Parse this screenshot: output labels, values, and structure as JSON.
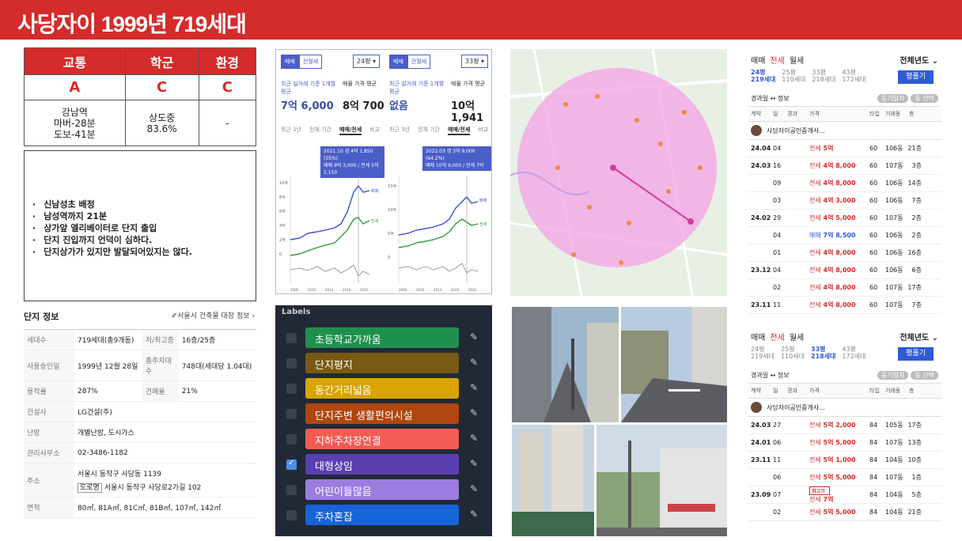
{
  "title": "사당자이 1999년 719세대",
  "rating": {
    "headers": [
      "교통",
      "학군",
      "환경"
    ],
    "grades": [
      "A",
      "C",
      "C"
    ],
    "details": [
      [
        "강남역",
        "마버-28분",
        "도보-41분"
      ],
      [
        "상도중",
        "83.6%"
      ],
      [
        "-"
      ]
    ]
  },
  "notes": [
    "신남성초 배정",
    "남성역까지 21분",
    "상가앞 엘리베이터로 단지 출입",
    "단지 진입까지 언덕이 심하다.",
    "단지상가가 있지만 발달되어있지는 않다."
  ],
  "info": {
    "title": "단지 정보",
    "link": "서울시 건축물 대장 정보",
    "rows": [
      {
        "k1": "세대수",
        "v1": "719세대(총9개동)",
        "k2": "저/최고층",
        "v2": "16층/25층"
      },
      {
        "k1": "사용승인일",
        "v1": "1999년 12월 28일",
        "k2": "총주차대수",
        "v2": "748대(세대당 1.04대)"
      },
      {
        "k1": "용적률",
        "v1": "287%",
        "k2": "건폐율",
        "v2": "21%"
      }
    ],
    "builder": {
      "k": "건설사",
      "v": "LG건설(주)"
    },
    "heating": {
      "k": "난방",
      "v": "개별난방, 도시가스"
    },
    "office": {
      "k": "관리사무소",
      "v": "02-3486-1182"
    },
    "address": {
      "k": "주소",
      "v1": "서울시 동작구 사당동 1139",
      "badge": "도로명",
      "v2": "서울시 동작구 사당로2가길 102"
    },
    "area": {
      "k": "면적",
      "v": "80㎡, 81A㎡, 81C㎡, 81B㎡, 107㎡, 142㎡"
    }
  },
  "charts": [
    {
      "tab1": "매매",
      "tab2": "전월세",
      "select": "24평",
      "label1": "최근 실거래 기준 1개월 평균",
      "value1": "7억 6,000",
      "label2": "매물 가격 평균",
      "value2": "8억 700",
      "subtabs": [
        "최근 3년",
        "전체 기간",
        "매매/전세",
        "비교"
      ],
      "tip1": "2021.10  갭 4억 1,850 (55%)",
      "tip2": "매매 9억 3,000 / 전세 5억 1,150",
      "legend": [
        "매매",
        "전세"
      ],
      "y_ticks": [
        "10억",
        "8억",
        "6억",
        "4억",
        "2억",
        "0"
      ],
      "x_ticks": [
        "2006",
        "2008",
        "2010",
        "2012",
        "2014",
        "2016",
        "2018",
        "2020",
        "2022",
        "2024"
      ]
    },
    {
      "tab1": "매매",
      "tab2": "전월세",
      "select": "33평",
      "label1": "최근 실거래 기준 1개월 평균",
      "value1": "없음",
      "label2": "매물 가격 평균",
      "value2": "10억 1,941",
      "subtabs": [
        "최근 3년",
        "전체 기간",
        "매매/전세",
        "비교"
      ],
      "tip1": "2022.03  갭 3억 9,000 (64.2%)",
      "tip2": "매매 10억 9,000 / 전세 7억",
      "legend": [
        "매매",
        "전세"
      ],
      "y_ticks": [
        "15억",
        "10억",
        "5억",
        "0"
      ],
      "x_ticks": [
        "2006",
        "2008",
        "2010",
        "2012",
        "2014",
        "2016",
        "2018",
        "2020",
        "2022",
        "2024"
      ]
    }
  ],
  "labels": {
    "heading": "Labels",
    "items": [
      {
        "text": "초등학교가까움",
        "color": "#1f8f4e",
        "checked": false
      },
      {
        "text": "단지평지",
        "color": "#7a5a12",
        "checked": false
      },
      {
        "text": "동간거리넓음",
        "color": "#d9a300",
        "checked": false
      },
      {
        "text": "단지주변 생활편의시설",
        "color": "#b0470f",
        "checked": false
      },
      {
        "text": "지하주차장연결",
        "color": "#f25c54",
        "checked": false
      },
      {
        "text": "대형상임",
        "color": "#5a3fb3",
        "checked": true
      },
      {
        "text": "어린이들많음",
        "color": "#9b7de0",
        "checked": false
      },
      {
        "text": "주차혼잡",
        "color": "#1565d8",
        "checked": false
      }
    ]
  },
  "map": {
    "fill": "#f2a7e6",
    "base": "#e8efe4"
  },
  "listings": [
    {
      "tabs": [
        "매매",
        "전세",
        "월세"
      ],
      "active": 1,
      "year": "전체년도",
      "sizes": [
        [
          "24평",
          "219세대"
        ],
        [
          "25평",
          "110세대"
        ],
        [
          "33평",
          "218세대"
        ],
        [
          "43평",
          "172세대"
        ]
      ],
      "active_size": 0,
      "button": "평플기",
      "sort": "경과일 ↔ 정보",
      "badges": [
        "등기일자",
        "동 선택"
      ],
      "cols": [
        "계약",
        "일",
        "경과",
        "가격",
        "타입",
        "거래동",
        "층"
      ],
      "agent": "사당자이공인중개사...",
      "rows": [
        {
          "m": "24.04",
          "d": "04",
          "type": "전세",
          "price": "5억",
          "a": "60",
          "dong": "106동",
          "fl": "21층"
        },
        {
          "m": "24.03",
          "d": "16",
          "type": "전세",
          "price": "4억 8,000",
          "a": "60",
          "dong": "107동",
          "fl": "3층"
        },
        {
          "m": "",
          "d": "09",
          "type": "전세",
          "price": "4억 8,000",
          "a": "60",
          "dong": "106동",
          "fl": "14층"
        },
        {
          "m": "",
          "d": "03",
          "type": "전세",
          "price": "4억 3,000",
          "a": "60",
          "dong": "106동",
          "fl": "7층"
        },
        {
          "m": "24.02",
          "d": "29",
          "type": "전세",
          "price": "4억 5,000",
          "a": "60",
          "dong": "107동",
          "fl": "2층"
        },
        {
          "m": "",
          "d": "04",
          "type": "매매",
          "price": "7억 8,500",
          "a": "60",
          "dong": "106동",
          "fl": "2층"
        },
        {
          "m": "",
          "d": "01",
          "type": "전세",
          "price": "4억 8,000",
          "a": "60",
          "dong": "106동",
          "fl": "16층"
        },
        {
          "m": "23.12",
          "d": "04",
          "type": "전세",
          "price": "4억 8,000",
          "a": "60",
          "dong": "106동",
          "fl": "6층"
        },
        {
          "m": "",
          "d": "02",
          "type": "전세",
          "price": "4억 8,000",
          "a": "60",
          "dong": "107동",
          "fl": "17층"
        },
        {
          "m": "23.11",
          "d": "11",
          "type": "전세",
          "price": "4억 8,000",
          "a": "60",
          "dong": "107동",
          "fl": "7층"
        }
      ]
    },
    {
      "tabs": [
        "매매",
        "전세",
        "월세"
      ],
      "active": 1,
      "year": "전체년도",
      "sizes": [
        [
          "24평",
          "219세대"
        ],
        [
          "25평",
          "110세대"
        ],
        [
          "33평",
          "218세대"
        ],
        [
          "43평",
          "172세대"
        ]
      ],
      "active_size": 2,
      "button": "평플기",
      "sort": "경과일 ↔ 정보",
      "badges": [
        "등기일자",
        "동 선택"
      ],
      "cols": [
        "계약",
        "일",
        "경과",
        "가격",
        "타입",
        "거래동",
        "층"
      ],
      "agent": "사당자이공인중개사...",
      "rows": [
        {
          "m": "24.03",
          "d": "27",
          "type": "전세",
          "price": "5억 2,000",
          "a": "84",
          "dong": "105동",
          "fl": "17층"
        },
        {
          "m": "24.01",
          "d": "06",
          "type": "전세",
          "price": "5억 5,000",
          "a": "84",
          "dong": "107동",
          "fl": "13층"
        },
        {
          "m": "23.11",
          "d": "11",
          "type": "전세",
          "price": "5억 1,000",
          "a": "84",
          "dong": "104동",
          "fl": "10층"
        },
        {
          "m": "",
          "d": "06",
          "type": "전세",
          "price": "5억 5,000",
          "a": "84",
          "dong": "107동",
          "fl": "1층"
        },
        {
          "m": "23.09",
          "d": "07",
          "type": "전세",
          "price": "7억",
          "a": "84",
          "dong": "104동",
          "fl": "5층",
          "tag": "최고가"
        },
        {
          "m": "",
          "d": "02",
          "type": "전세",
          "price": "5억 5,000",
          "a": "84",
          "dong": "104동",
          "fl": "21층"
        }
      ]
    }
  ]
}
